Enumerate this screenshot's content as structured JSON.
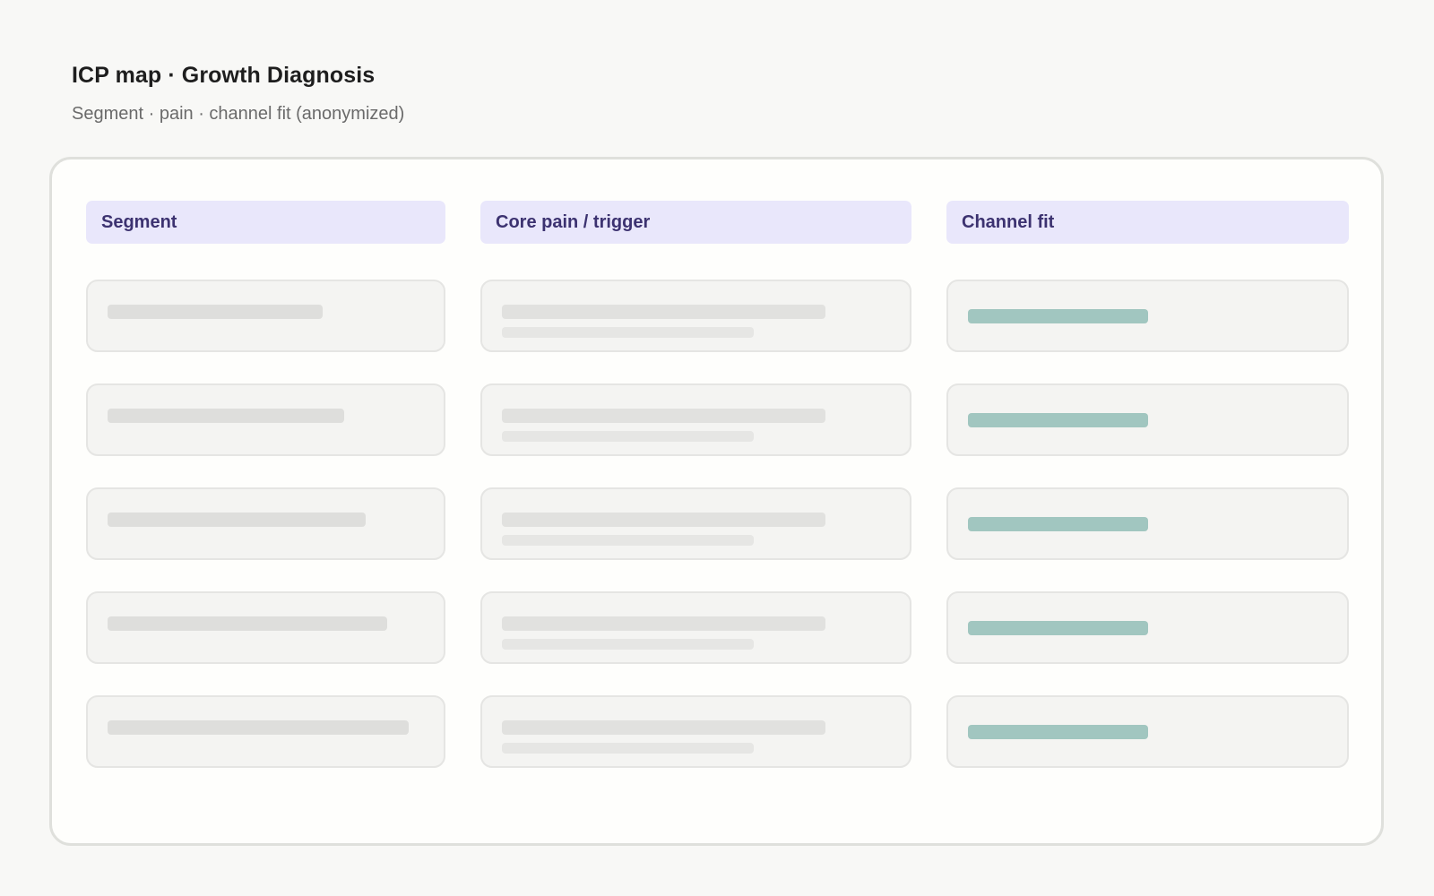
{
  "header": {
    "title": "ICP map · Growth Diagnosis",
    "subtitle": "Segment · pain · channel fit (anonymized)"
  },
  "columns": [
    {
      "key": "segment",
      "label": "Segment"
    },
    {
      "key": "pain",
      "label": "Core pain / trigger"
    },
    {
      "key": "channel",
      "label": "Channel fit"
    }
  ],
  "rows": [
    {
      "segment_fill": 0.6,
      "pain_fill": [
        0.75,
        0.58
      ],
      "channel_fill": 0.45
    },
    {
      "segment_fill": 0.66,
      "pain_fill": [
        0.75,
        0.58
      ],
      "channel_fill": 0.45
    },
    {
      "segment_fill": 0.72,
      "pain_fill": [
        0.75,
        0.58
      ],
      "channel_fill": 0.45
    },
    {
      "segment_fill": 0.78,
      "pain_fill": [
        0.75,
        0.58
      ],
      "channel_fill": 0.45
    },
    {
      "segment_fill": 0.84,
      "pain_fill": [
        0.75,
        0.58
      ],
      "channel_fill": 0.45
    }
  ],
  "colors": {
    "background": "#F8F8F6",
    "board": "#FEFEFC",
    "header_fill": "#E9E7FB",
    "header_text": "#3C3270",
    "placeholder_bar": "#DEDEDC",
    "channel_bar": "#A1C6C0"
  }
}
